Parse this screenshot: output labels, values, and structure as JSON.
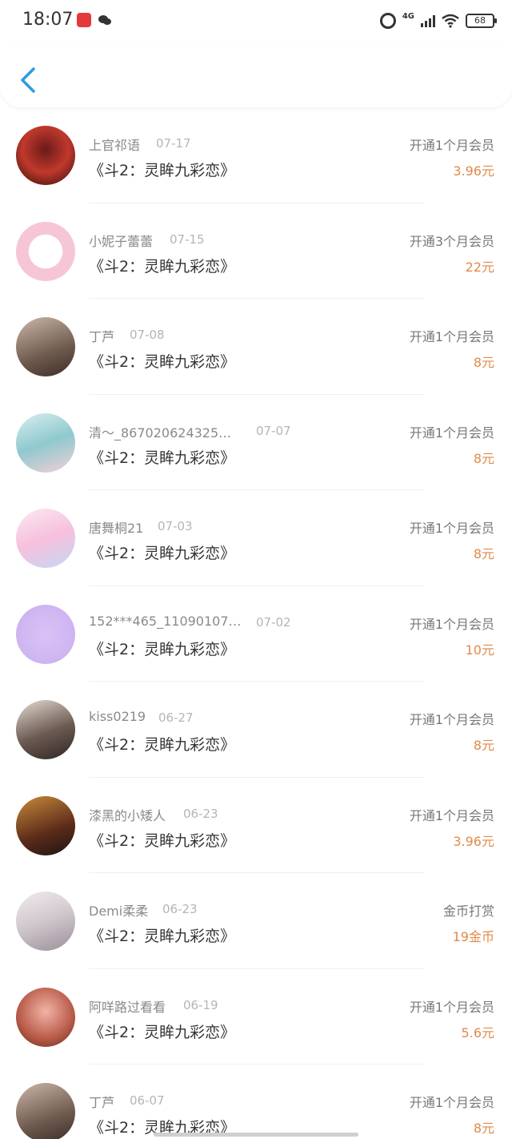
{
  "status_bar": {
    "time": "18:07",
    "network": "4G",
    "battery": "68"
  },
  "nav": {
    "back_icon": "chevron-left-icon"
  },
  "colors": {
    "accent": "#2f9ae0",
    "price": "#e08a4a"
  },
  "records": [
    {
      "name": "上官祁语",
      "date": "07-17",
      "title": "《斗2：灵眸九彩恋》",
      "action": "开通1个月会员",
      "amount": "3.96元"
    },
    {
      "name": "小妮子蕾蕾",
      "date": "07-15",
      "title": "《斗2：灵眸九彩恋》",
      "action": "开通3个月会员",
      "amount": "22元"
    },
    {
      "name": "丁芦",
      "date": "07-08",
      "title": "《斗2：灵眸九彩恋》",
      "action": "开通1个月会员",
      "amount": "8元"
    },
    {
      "name": "清～_867020624325…",
      "date": "07-07",
      "title": "《斗2：灵眸九彩恋》",
      "action": "开通1个月会员",
      "amount": "8元"
    },
    {
      "name": "唐舞桐21",
      "date": "07-03",
      "title": "《斗2：灵眸九彩恋》",
      "action": "开通1个月会员",
      "amount": "8元"
    },
    {
      "name": "152***465_11090107…",
      "date": "07-02",
      "title": "《斗2：灵眸九彩恋》",
      "action": "开通1个月会员",
      "amount": "10元"
    },
    {
      "name": "kiss0219",
      "date": "06-27",
      "title": "《斗2：灵眸九彩恋》",
      "action": "开通1个月会员",
      "amount": "8元"
    },
    {
      "name": "漆黑的小矮人",
      "date": "06-23",
      "title": "《斗2：灵眸九彩恋》",
      "action": "开通1个月会员",
      "amount": "3.96元"
    },
    {
      "name": "Demi柔柔",
      "date": "06-23",
      "title": "《斗2：灵眸九彩恋》",
      "action": "金币打赏",
      "amount": "19金币"
    },
    {
      "name": "阿咩路过看看",
      "date": "06-19",
      "title": "《斗2：灵眸九彩恋》",
      "action": "开通1个月会员",
      "amount": "5.6元"
    },
    {
      "name": "丁芦",
      "date": "06-07",
      "title": "《斗2：灵眸九彩恋》",
      "action": "开通1个月会员",
      "amount": "8元"
    }
  ]
}
